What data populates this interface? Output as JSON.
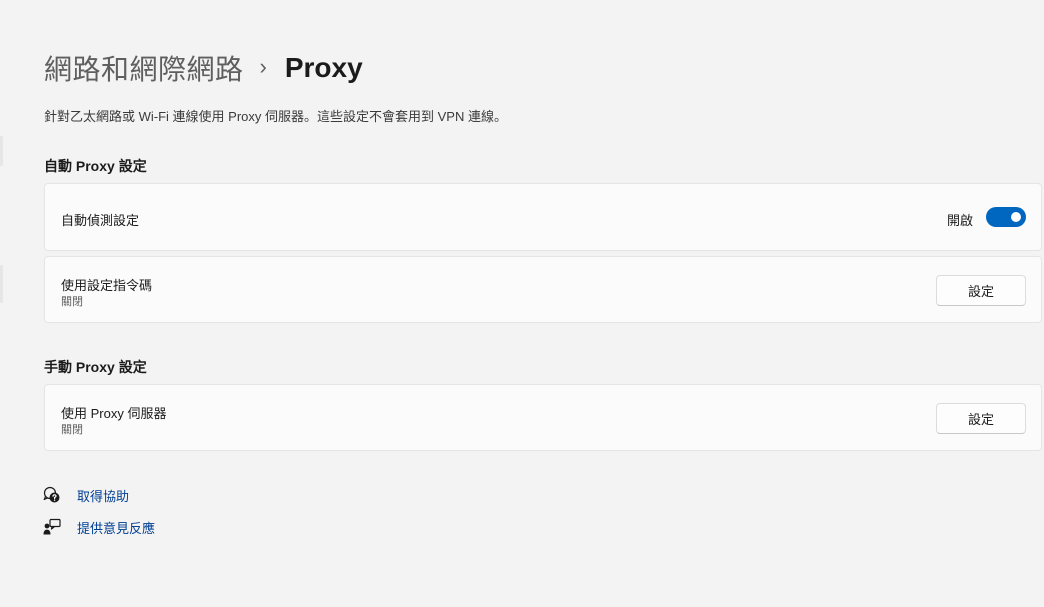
{
  "breadcrumb": {
    "parent": "網路和網際網路",
    "separator": "›",
    "current": "Proxy"
  },
  "description": "針對乙太網路或 Wi-Fi 連線使用 Proxy 伺服器。這些設定不會套用到 VPN 連線。",
  "auto_proxy": {
    "header": "自動 Proxy 設定",
    "auto_detect": {
      "title": "自動偵測設定",
      "toggle_label": "開啟",
      "toggle_on": true
    },
    "setup_script": {
      "title": "使用設定指令碼",
      "status": "關閉",
      "button": "設定"
    }
  },
  "manual_proxy": {
    "header": "手動 Proxy 設定",
    "use_proxy": {
      "title": "使用 Proxy 伺服器",
      "status": "關閉",
      "button": "設定"
    }
  },
  "links": {
    "help": "取得協助",
    "feedback": "提供意見反應"
  },
  "colors": {
    "accent": "#0067c0",
    "link": "#003e92",
    "background": "#f3f3f3",
    "card": "#fbfbfb"
  },
  "icons": {
    "help": "help-chat-icon",
    "feedback": "feedback-icon"
  }
}
